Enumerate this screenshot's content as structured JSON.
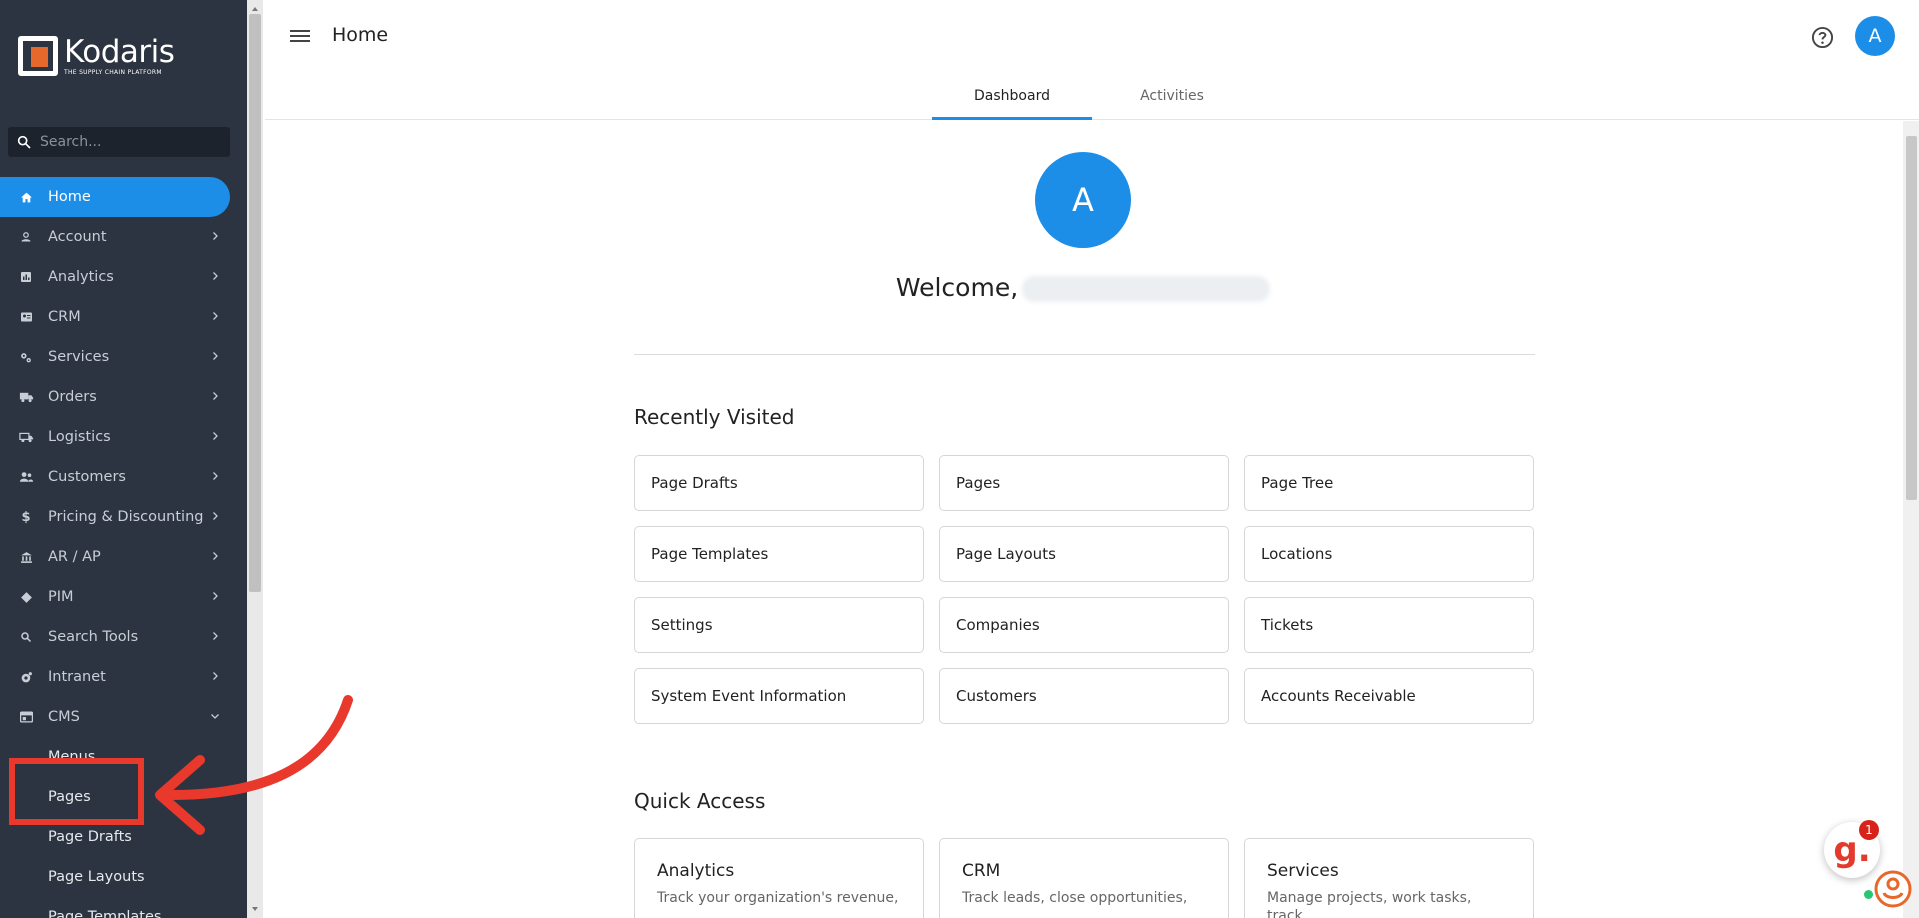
{
  "brand": {
    "name": "Kodaris",
    "tagline": "THE SUPPLY CHAIN PLATFORM",
    "accent": "#1d8ee8",
    "logo_color": "#e6682b",
    "sidebar_bg": "#2b3440"
  },
  "sidebar": {
    "search_placeholder": "Search...",
    "items": [
      {
        "label": "Home",
        "icon": "home-icon",
        "active": true
      },
      {
        "label": "Account",
        "icon": "account-icon"
      },
      {
        "label": "Analytics",
        "icon": "analytics-icon"
      },
      {
        "label": "CRM",
        "icon": "crm-icon"
      },
      {
        "label": "Services",
        "icon": "services-icon"
      },
      {
        "label": "Orders",
        "icon": "truck-icon"
      },
      {
        "label": "Logistics",
        "icon": "logistics-icon"
      },
      {
        "label": "Customers",
        "icon": "customers-icon"
      },
      {
        "label": "Pricing & Discounting",
        "icon": "dollar-icon"
      },
      {
        "label": "AR / AP",
        "icon": "bank-icon"
      },
      {
        "label": "PIM",
        "icon": "tag-icon"
      },
      {
        "label": "Search Tools",
        "icon": "search-icon"
      },
      {
        "label": "Intranet",
        "icon": "intranet-icon"
      },
      {
        "label": "CMS",
        "icon": "cms-icon",
        "expanded": true
      }
    ],
    "cms_sub_items": [
      {
        "label": "Menus"
      },
      {
        "label": "Pages"
      },
      {
        "label": "Page Drafts"
      },
      {
        "label": "Page Layouts"
      },
      {
        "label": "Page Templates"
      }
    ]
  },
  "header": {
    "title": "Home",
    "avatar_letter": "A",
    "tabs": [
      {
        "label": "Dashboard",
        "active": true
      },
      {
        "label": "Activities"
      }
    ]
  },
  "main": {
    "avatar_letter": "A",
    "welcome": "Welcome,",
    "recently_visited_title": "Recently Visited",
    "recently_visited": [
      "Page Drafts",
      "Pages",
      "Page Tree",
      "Page Templates",
      "Page Layouts",
      "Locations",
      "Settings",
      "Companies",
      "Tickets",
      "System Event Information",
      "Customers",
      "Accounts Receivable"
    ],
    "quick_access_title": "Quick Access",
    "quick_access": [
      {
        "title": "Analytics",
        "desc": "Track your organization's revenue,"
      },
      {
        "title": "CRM",
        "desc": "Track leads, close opportunities,"
      },
      {
        "title": "Services",
        "desc": "Manage projects, work tasks, track"
      }
    ]
  },
  "widget": {
    "letter": "g.",
    "badge": "1"
  }
}
